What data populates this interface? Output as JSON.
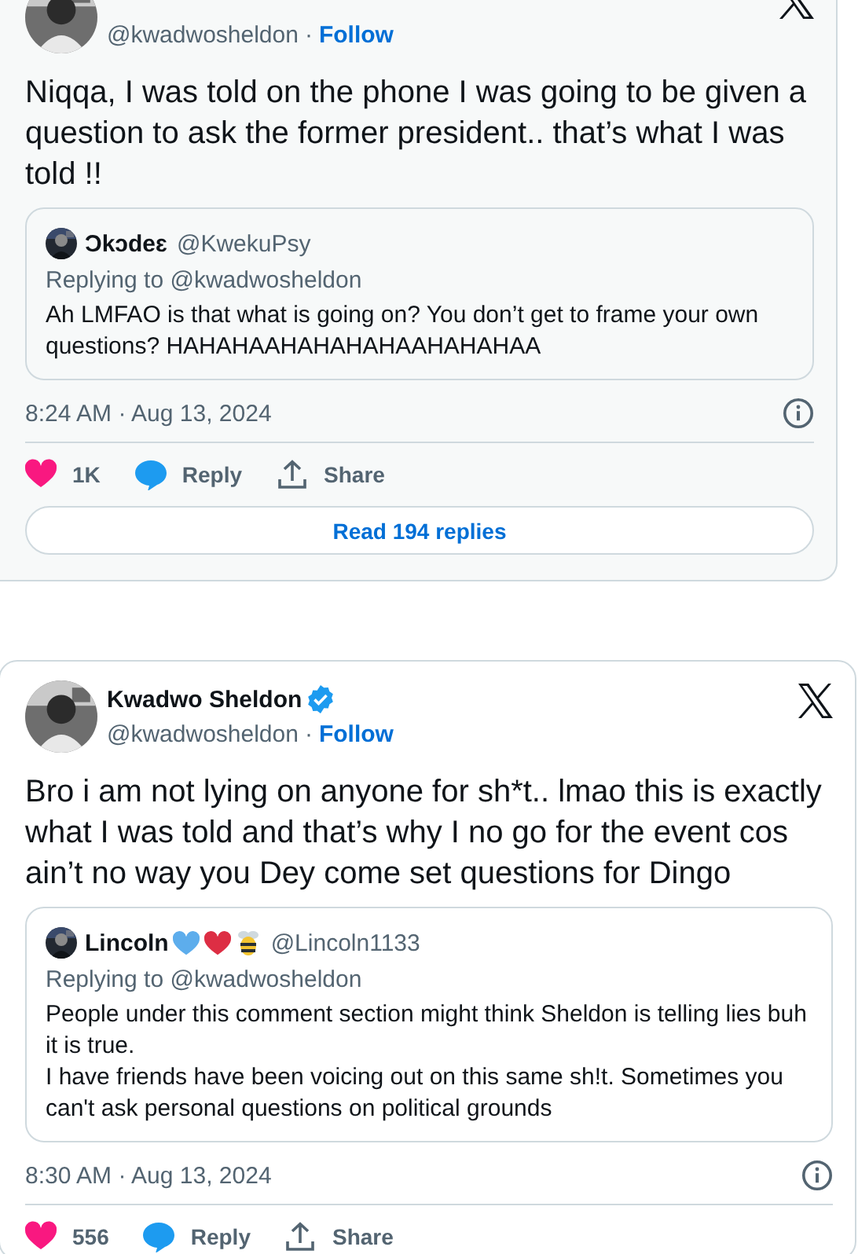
{
  "tweets": [
    {
      "highlighted": true,
      "author": {
        "handle": "@kwadwosheldon",
        "separator": "·",
        "follow": "Follow"
      },
      "text": "Niqqa, I was told on the phone I was going to be given a question to ask the former president.. that’s what I was told !!",
      "quote": {
        "name": "Ɔkɔdeɛ",
        "handle": "@KwekuPsy",
        "replying": "Replying to @kwadwosheldon",
        "text": [
          "Ah LMFAO is that what is going on? You don’t get to frame your own questions? HAHAHAAHAHAHAHAAHAHAHAA"
        ]
      },
      "time": "8:24 AM · Aug 13, 2024",
      "actions": [
        {
          "kind": "like",
          "label": "1K"
        },
        {
          "kind": "reply",
          "label": "Reply"
        },
        {
          "kind": "share",
          "label": "Share"
        }
      ],
      "read_replies": "Read 194 replies"
    },
    {
      "highlighted": false,
      "author": {
        "name": "Kwadwo Sheldon",
        "verified": true,
        "handle": "@kwadwosheldon",
        "separator": "·",
        "follow": "Follow"
      },
      "text": "Bro i am not lying on anyone for sh*t.. lmao this is exactly what I was told and that’s why I no go for the event cos ain’t no way you Dey come set questions for Dingo",
      "quote": {
        "name": "Lincoln",
        "name_icons": [
          {
            "kind": "heart",
            "color": "#5dadec"
          },
          {
            "kind": "heart",
            "color": "#dd2e44"
          },
          {
            "kind": "bee"
          }
        ],
        "handle": "@Lincoln1133",
        "replying": "Replying to @kwadwosheldon",
        "text": [
          "People under this comment section might think Sheldon is telling lies buh it is true.",
          "I have friends have been voicing out on this same sh!t. Sometimes you can't ask personal questions on political grounds"
        ]
      },
      "time": "8:30 AM · Aug 13, 2024",
      "actions": [
        {
          "kind": "like",
          "label": "556"
        },
        {
          "kind": "reply",
          "label": "Reply"
        },
        {
          "kind": "share",
          "label": "Share"
        }
      ]
    }
  ]
}
